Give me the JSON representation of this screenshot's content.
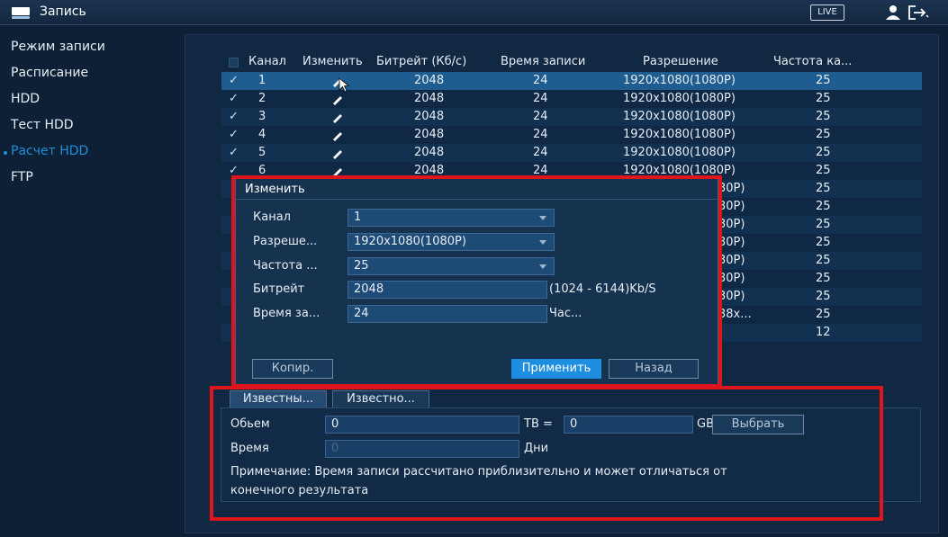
{
  "header": {
    "title": "Запись",
    "live_label": "LIVE"
  },
  "sidebar": {
    "items": [
      {
        "label": "Режим записи"
      },
      {
        "label": "Расписание"
      },
      {
        "label": "HDD"
      },
      {
        "label": "Тест HDD"
      },
      {
        "label": "Расчет HDD",
        "active": true
      },
      {
        "label": "FTP"
      }
    ]
  },
  "table": {
    "headers": {
      "channel": "Канал",
      "edit": "Изменить",
      "bitrate": "Битрейт (Кб/с)",
      "rec_time": "Время записи",
      "resolution": "Разрешение",
      "fps": "Частота ка..."
    },
    "rows": [
      {
        "check": "✓",
        "channel": "1",
        "bitrate": "2048",
        "rec_time": "24",
        "resolution": "1920x1080(1080P)",
        "fps": "25"
      },
      {
        "check": "✓",
        "channel": "2",
        "bitrate": "2048",
        "rec_time": "24",
        "resolution": "1920x1080(1080P)",
        "fps": "25"
      },
      {
        "check": "✓",
        "channel": "3",
        "bitrate": "2048",
        "rec_time": "24",
        "resolution": "1920x1080(1080P)",
        "fps": "25"
      },
      {
        "check": "✓",
        "channel": "4",
        "bitrate": "2048",
        "rec_time": "24",
        "resolution": "1920x1080(1080P)",
        "fps": "25"
      },
      {
        "check": "✓",
        "channel": "5",
        "bitrate": "2048",
        "rec_time": "24",
        "resolution": "1920x1080(1080P)",
        "fps": "25"
      },
      {
        "check": "✓",
        "channel": "6",
        "bitrate": "2048",
        "rec_time": "24",
        "resolution": "1920x1080(1080P)",
        "fps": "25"
      },
      {
        "check": "",
        "channel": "",
        "bitrate": "",
        "rec_time": "",
        "resolution": "30P)",
        "fps": "25"
      },
      {
        "check": "",
        "channel": "",
        "bitrate": "",
        "rec_time": "",
        "resolution": "30P)",
        "fps": "25"
      },
      {
        "check": "",
        "channel": "",
        "bitrate": "",
        "rec_time": "",
        "resolution": "30P)",
        "fps": "25"
      },
      {
        "check": "",
        "channel": "",
        "bitrate": "",
        "rec_time": "",
        "resolution": "30P)",
        "fps": "25"
      },
      {
        "check": "",
        "channel": "",
        "bitrate": "",
        "rec_time": "",
        "resolution": "30P)",
        "fps": "25"
      },
      {
        "check": "",
        "channel": "",
        "bitrate": "",
        "rec_time": "",
        "resolution": "30P)",
        "fps": "25"
      },
      {
        "check": "",
        "channel": "",
        "bitrate": "",
        "rec_time": "",
        "resolution": "30P)",
        "fps": "25"
      },
      {
        "check": "",
        "channel": "",
        "bitrate": "",
        "rec_time": "",
        "resolution": "38x...",
        "fps": "25"
      },
      {
        "check": "",
        "channel": "",
        "bitrate": "",
        "rec_time": "",
        "resolution": "",
        "fps": "12"
      }
    ]
  },
  "dialog": {
    "title": "Изменить",
    "fields": {
      "channel_label": "Канал",
      "channel_value": "1",
      "resolution_label": "Разреше...",
      "resolution_value": "1920x1080(1080P)",
      "fps_label": "Частота ...",
      "fps_value": "25",
      "bitrate_label": "Битрейт",
      "bitrate_value": "2048",
      "bitrate_hint": "(1024 - 6144)Kb/S",
      "time_label": "Время за...",
      "time_value": "24",
      "time_unit": "Час..."
    },
    "copy_label": "Копир.",
    "apply_label": "Применить",
    "back_label": "Назад"
  },
  "calc": {
    "tabs": [
      "Известны...",
      "Известно..."
    ],
    "volume_label": "Обьем",
    "volume_value": "0",
    "tb_label": "ТВ =",
    "gb_value": "0",
    "gb_label": "GB",
    "select_label": "Выбрать",
    "time_label": "Время",
    "time_value": "0",
    "days_label": "Дни",
    "note_line1": "Примечание: Время записи рассчитано приблизительно и может отличаться от",
    "note_line2": "конечного результата"
  },
  "colors": {
    "accent": "#1e8ee0",
    "highlight": "#e0141b",
    "background": "#0d2036"
  }
}
